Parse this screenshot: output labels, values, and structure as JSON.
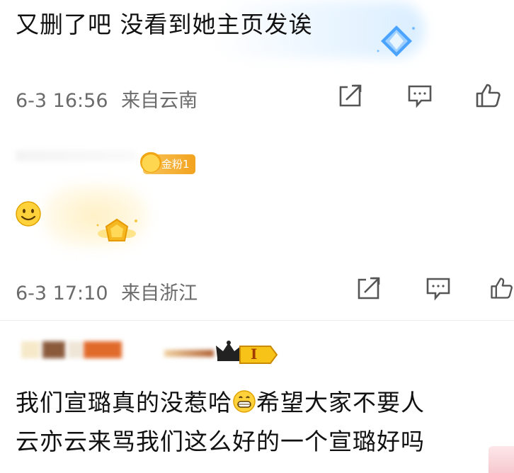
{
  "comments": [
    {
      "text": "又删了吧 没看到她主页发诶",
      "date": "6-3 16:56",
      "location": "来自云南"
    },
    {
      "badge": "金粉1",
      "date": "6-3 17:10",
      "location": "来自浙江"
    },
    {
      "badge_level": "I",
      "text_line1": "我们宣璐真的没惹哈",
      "text_line1b": "希望大家不要人",
      "text_line2": "云亦云来骂我们这么好的一个宣璐好吗"
    }
  ],
  "icons": {
    "share": "share-icon",
    "comment": "comment-icon",
    "like": "thumbs-up-icon",
    "smile": "smile-emoji-icon",
    "grin": "grin-emoji-icon"
  },
  "colors": {
    "meta": "#6b6b6b",
    "badge": "#f3a21e",
    "text": "#111111"
  }
}
